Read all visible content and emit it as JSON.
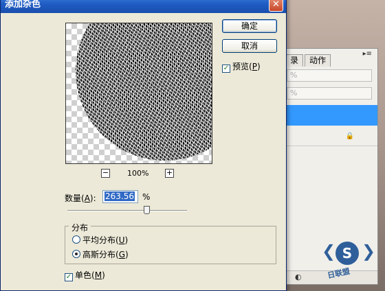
{
  "dialog": {
    "title": "添加杂色",
    "close_glyph": "✕",
    "ok_label": "确定",
    "cancel_label": "取消",
    "preview_check": {
      "label": "预览",
      "key": "P",
      "checked": true
    },
    "zoom": {
      "minus": "−",
      "plus": "+",
      "value": "100%"
    },
    "amount": {
      "label": "数量",
      "key": "A",
      "value": "263.56",
      "unit": "%",
      "slider_fraction": 0.66
    },
    "distribution": {
      "title": "分布",
      "options": [
        {
          "label": "平均分布",
          "key": "U",
          "selected": false
        },
        {
          "label": "高斯分布",
          "key": "G",
          "selected": true
        }
      ]
    },
    "monochrome": {
      "label": "单色",
      "key": "M",
      "checked": true
    }
  },
  "panel": {
    "tabs": [
      "录",
      "动作"
    ],
    "menu_glyph": "▸≡",
    "row1": "%",
    "row2": "%",
    "lock_glyph": "🔒"
  },
  "watermark": {
    "letter": "S",
    "text": "日联盟"
  },
  "colors": {
    "title_bar": "#1f5cc4",
    "selection": "#3399ff",
    "dialog_bg": "#ece9d8"
  }
}
